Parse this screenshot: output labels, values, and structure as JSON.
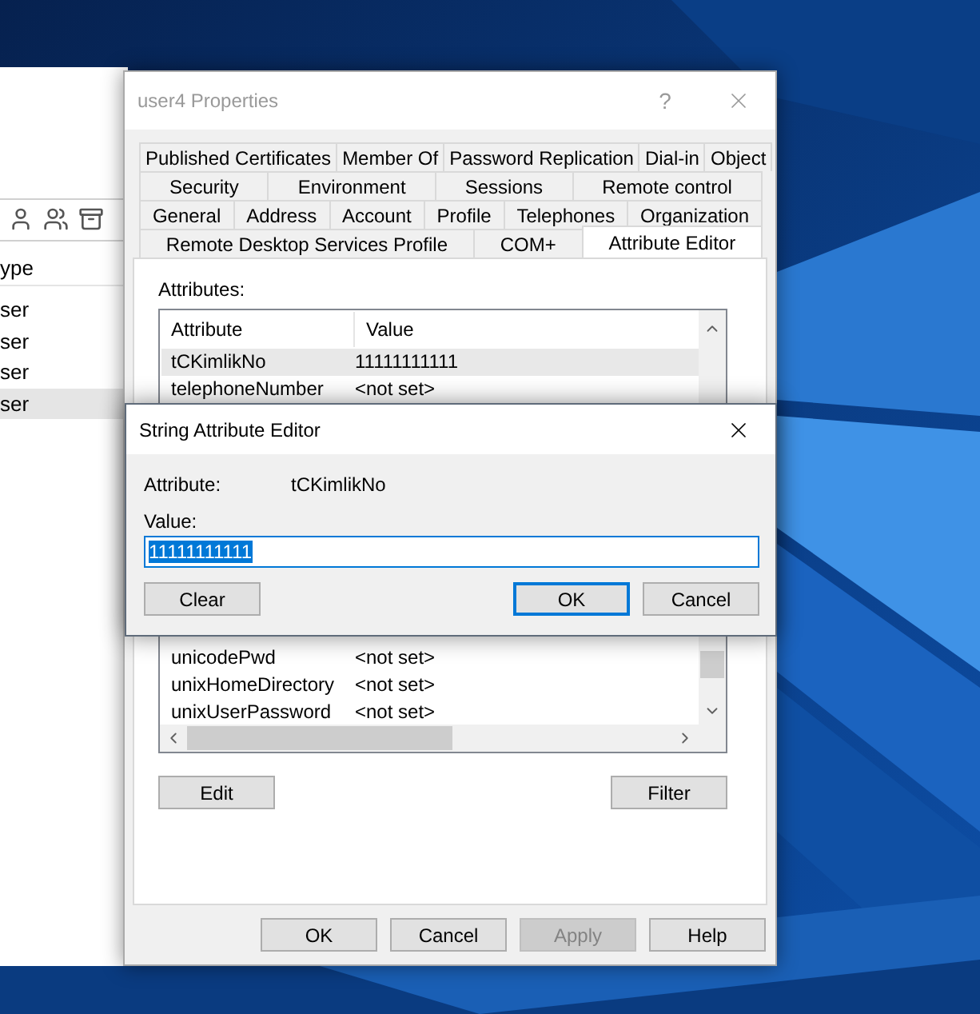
{
  "background_window": {
    "column_header": "ype",
    "rows": [
      {
        "text": "ser",
        "selected": false
      },
      {
        "text": "ser",
        "selected": false
      },
      {
        "text": "ser",
        "selected": false
      },
      {
        "text": "ser",
        "selected": true
      }
    ]
  },
  "properties": {
    "title": "user4 Properties",
    "help": "?",
    "tab_rows": [
      [
        {
          "label": "Published Certificates",
          "selected": false
        },
        {
          "label": "Member Of",
          "selected": false
        },
        {
          "label": "Password Replication",
          "selected": false
        },
        {
          "label": "Dial-in",
          "selected": false
        },
        {
          "label": "Object",
          "selected": false
        }
      ],
      [
        {
          "label": "Security",
          "selected": false
        },
        {
          "label": "Environment",
          "selected": false
        },
        {
          "label": "Sessions",
          "selected": false
        },
        {
          "label": "Remote control",
          "selected": false
        }
      ],
      [
        {
          "label": "General",
          "selected": false
        },
        {
          "label": "Address",
          "selected": false
        },
        {
          "label": "Account",
          "selected": false
        },
        {
          "label": "Profile",
          "selected": false
        },
        {
          "label": "Telephones",
          "selected": false
        },
        {
          "label": "Organization",
          "selected": false
        }
      ],
      [
        {
          "label": "Remote Desktop Services Profile",
          "selected": false
        },
        {
          "label": "COM+",
          "selected": false
        },
        {
          "label": "Attribute Editor",
          "selected": true
        }
      ]
    ],
    "attributes_label": "Attributes:",
    "columns": [
      "Attribute",
      "Value"
    ],
    "rows": [
      {
        "attribute": "tCKimlikNo",
        "value": "11111111111",
        "selected": true
      },
      {
        "attribute": "telephoneNumber",
        "value": "<not set>",
        "selected": false
      }
    ],
    "more_rows": [
      {
        "attribute": "unicodePwd",
        "value": "<not set>",
        "selected": false
      },
      {
        "attribute": "unixHomeDirectory",
        "value": "<not set>",
        "selected": false
      },
      {
        "attribute": "unixUserPassword",
        "value": "<not set>",
        "selected": false
      }
    ],
    "list_buttons": [
      "Edit",
      "Filter"
    ],
    "footer_buttons": [
      {
        "label": "OK",
        "disabled": false
      },
      {
        "label": "Cancel",
        "disabled": false
      },
      {
        "label": "Apply",
        "disabled": true
      },
      {
        "label": "Help",
        "disabled": false
      }
    ]
  },
  "string_editor": {
    "title": "String Attribute Editor",
    "attribute_label": "Attribute:",
    "attribute_value": "tCKimlikNo",
    "value_label": "Value:",
    "value": "11111111111",
    "value_selected": true,
    "buttons": [
      {
        "label": "Clear",
        "default": false
      },
      {
        "label": "OK",
        "default": true
      },
      {
        "label": "Cancel",
        "default": false
      }
    ]
  }
}
